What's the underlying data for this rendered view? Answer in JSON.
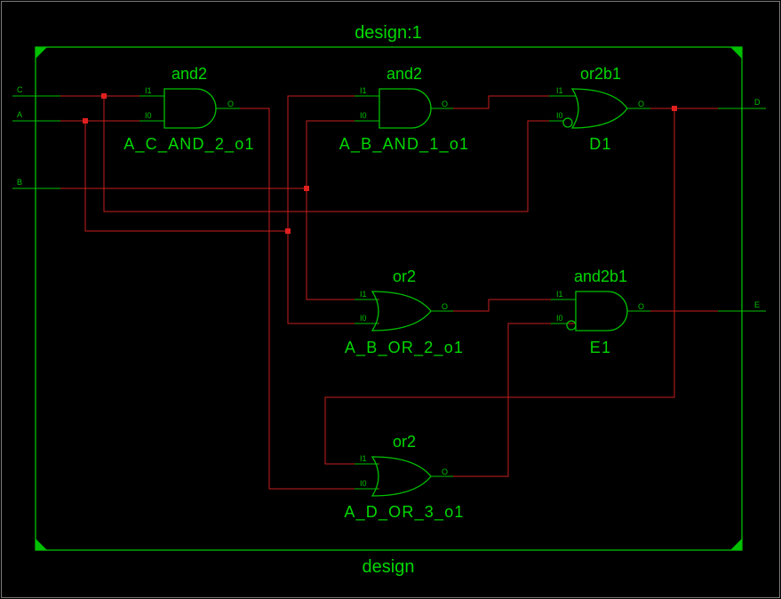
{
  "design": {
    "instance_title": "design:1",
    "module_title": "design"
  },
  "ports": {
    "inputs": [
      {
        "name": "C"
      },
      {
        "name": "A"
      },
      {
        "name": "B"
      }
    ],
    "outputs": [
      {
        "name": "D"
      },
      {
        "name": "E"
      }
    ]
  },
  "gates": [
    {
      "id": "g1",
      "type": "and2",
      "name": "A_C_AND_2_o1",
      "pins": {
        "in1": "I1",
        "in0": "I0",
        "out": "O"
      }
    },
    {
      "id": "g2",
      "type": "and2",
      "name": "A_B_AND_1_o1",
      "pins": {
        "in1": "I1",
        "in0": "I0",
        "out": "O"
      }
    },
    {
      "id": "g3",
      "type": "or2b1",
      "name": "D1",
      "pins": {
        "in1": "I1",
        "in0": "I0",
        "out": "O"
      }
    },
    {
      "id": "g4",
      "type": "or2",
      "name": "A_B_OR_2_o1",
      "pins": {
        "in1": "I1",
        "in0": "I0",
        "out": "O"
      }
    },
    {
      "id": "g5",
      "type": "and2b1",
      "name": "E1",
      "pins": {
        "in1": "I1",
        "in0": "I0",
        "out": "O"
      }
    },
    {
      "id": "g6",
      "type": "or2",
      "name": "A_D_OR_3_o1",
      "pins": {
        "in1": "I1",
        "in0": "I0",
        "out": "O"
      }
    }
  ],
  "colors": {
    "background": "#000000",
    "symbols": "#00c000",
    "wires": "#c81e1e",
    "junctions": "#e01f1f"
  }
}
